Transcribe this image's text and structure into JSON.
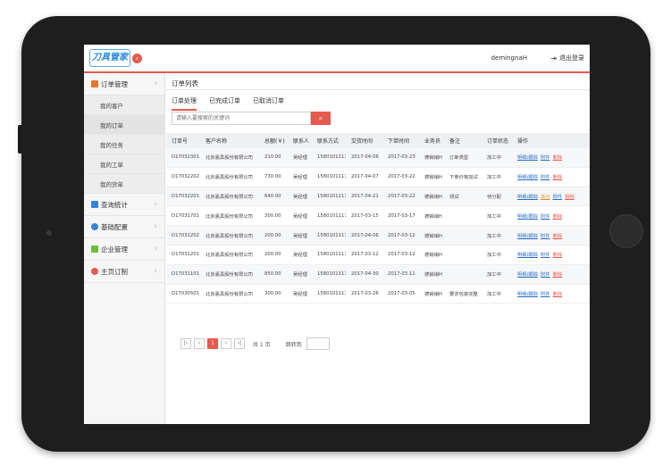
{
  "app": {
    "logo_text": "刀具管家",
    "username": "demingnaH",
    "logout_label": "退出登录"
  },
  "sidebar": {
    "groups": [
      {
        "label": "订单管理",
        "icon": "order-icon",
        "color": "#e07a2e"
      },
      {
        "label": "查询统计",
        "icon": "folder-icon",
        "color": "#3b82d6"
      },
      {
        "label": "基础配置",
        "icon": "config-icon",
        "color": "#3b82d6"
      },
      {
        "label": "企业管理",
        "icon": "database-icon",
        "color": "#6cbf3a"
      },
      {
        "label": "主页订制",
        "icon": "gear-icon",
        "color": "#e55a4f"
      }
    ],
    "sub_items": [
      "我的客户",
      "我的订单",
      "我的任务",
      "我的工单",
      "我的货单"
    ]
  },
  "main": {
    "page_title": "订单列表",
    "tabs": [
      "订单处理",
      "已完成订单",
      "已取消订单"
    ],
    "search_placeholder": "请输入要搜索的关键词",
    "columns": [
      "订单号",
      "客户名称",
      "总额(￥)",
      "联系人",
      "联系方式",
      "交货时间",
      "下单时间",
      "业务员",
      "备注",
      "订单状态",
      "操作"
    ],
    "rows": [
      {
        "id": "D17032301",
        "customer": "北京嘉具股份有限公司",
        "total": "210.00",
        "contact": "吴经理",
        "phone": "15801011111",
        "delivery": "2017-04-08",
        "ordered": "2017-03-23",
        "sales": "德销销H",
        "note": "订单类型",
        "status": "加工中",
        "ops": [
          "明细/跟踪",
          "附件",
          "删除"
        ]
      },
      {
        "id": "D17032202",
        "customer": "北京嘉具股份有限公司",
        "total": "730.00",
        "contact": "吴经理",
        "phone": "15801011111",
        "delivery": "2017-04-07",
        "ordered": "2017-03-22",
        "sales": "德销销H",
        "note": "下单价格加试",
        "status": "加工中",
        "ops": [
          "明细/跟踪",
          "附件",
          "删除"
        ]
      },
      {
        "id": "D17032201",
        "customer": "北京嘉具股份有限公司",
        "total": "640.00",
        "contact": "吴经理",
        "phone": "15801011111",
        "delivery": "2017-04-21",
        "ordered": "2017-03-22",
        "sales": "德销销H",
        "note": "测试",
        "status": "待分配",
        "ops": [
          "明细/跟踪",
          "派分",
          "附件",
          "删除"
        ]
      },
      {
        "id": "D17031701",
        "customer": "北京嘉具股份有限公司",
        "total": "300.00",
        "contact": "吴经理",
        "phone": "15801011111",
        "delivery": "2017-03-15",
        "ordered": "2017-03-17",
        "sales": "德销销H",
        "note": "",
        "status": "加工中",
        "ops": [
          "明细/跟踪",
          "附件",
          "删除"
        ]
      },
      {
        "id": "D17031202",
        "customer": "北京嘉具股份有限公司",
        "total": "200.00",
        "contact": "吴经理",
        "phone": "15801011111",
        "delivery": "2017-04-06",
        "ordered": "2017-03-12",
        "sales": "德销销H",
        "note": "",
        "status": "加工中",
        "ops": [
          "明细/跟踪",
          "附件",
          "删除"
        ]
      },
      {
        "id": "D17031201",
        "customer": "北京嘉具股份有限公司",
        "total": "200.00",
        "contact": "吴经理",
        "phone": "15801011111",
        "delivery": "2017-03-12",
        "ordered": "2017-03-12",
        "sales": "德销销H",
        "note": "",
        "status": "加工中",
        "ops": [
          "明细/跟踪",
          "附件",
          "删除"
        ]
      },
      {
        "id": "D17031101",
        "customer": "北京嘉具股份有限公司",
        "total": "850.00",
        "contact": "吴经理",
        "phone": "15801011111",
        "delivery": "2017-04-30",
        "ordered": "2017-03-11",
        "sales": "德销销H",
        "note": "",
        "status": "加工中",
        "ops": [
          "明细/跟踪",
          "附件",
          "删除"
        ]
      },
      {
        "id": "D17030501",
        "customer": "北京嘉具股份有限公司",
        "total": "300.00",
        "contact": "吴经理",
        "phone": "15801011111",
        "delivery": "2017-03-26",
        "ordered": "2017-03-05",
        "sales": "德销销H",
        "note": "要求包装完整",
        "status": "加工中",
        "ops": [
          "明细/跟踪",
          "附件",
          "删除"
        ]
      }
    ]
  },
  "pager": {
    "current_page": "1",
    "total_text": "共 1 页",
    "jump_label": "跳转到"
  },
  "colors": {
    "accent": "#e55a4f",
    "link": "#2a6fc4"
  }
}
